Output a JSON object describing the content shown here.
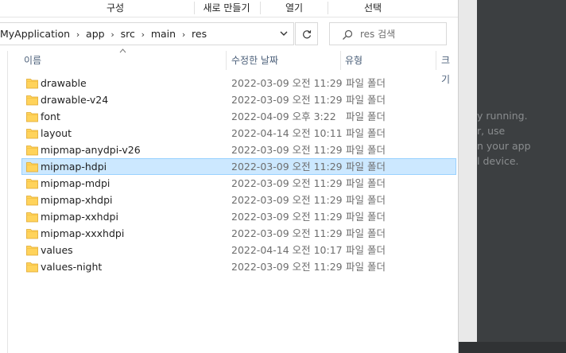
{
  "ribbon": {
    "tabs": [
      {
        "label": "구성"
      },
      {
        "label": "새로 만들기"
      },
      {
        "label": "열기"
      },
      {
        "label": "선택"
      }
    ]
  },
  "address": {
    "crumbs": [
      "MyApplication",
      "app",
      "src",
      "main",
      "res"
    ]
  },
  "search": {
    "placeholder": "res 검색"
  },
  "columns": {
    "name": "이름",
    "date": "수정한 날짜",
    "type": "유형",
    "size": "크기"
  },
  "files": [
    {
      "name": "drawable",
      "date": "2022-03-09 오전 11:29",
      "type": "파일 폴더"
    },
    {
      "name": "drawable-v24",
      "date": "2022-03-09 오전 11:29",
      "type": "파일 폴더"
    },
    {
      "name": "font",
      "date": "2022-04-09 오후 3:22",
      "type": "파일 폴더"
    },
    {
      "name": "layout",
      "date": "2022-04-14 오전 10:11",
      "type": "파일 폴더"
    },
    {
      "name": "mipmap-anydpi-v26",
      "date": "2022-03-09 오전 11:29",
      "type": "파일 폴더"
    },
    {
      "name": "mipmap-hdpi",
      "date": "2022-03-09 오전 11:29",
      "type": "파일 폴더",
      "selected": true
    },
    {
      "name": "mipmap-mdpi",
      "date": "2022-03-09 오전 11:29",
      "type": "파일 폴더"
    },
    {
      "name": "mipmap-xhdpi",
      "date": "2022-03-09 오전 11:29",
      "type": "파일 폴더"
    },
    {
      "name": "mipmap-xxhdpi",
      "date": "2022-03-09 오전 11:29",
      "type": "파일 폴더"
    },
    {
      "name": "mipmap-xxxhdpi",
      "date": "2022-03-09 오전 11:29",
      "type": "파일 폴더"
    },
    {
      "name": "values",
      "date": "2022-04-14 오전 10:17",
      "type": "파일 폴더"
    },
    {
      "name": "values-night",
      "date": "2022-03-09 오전 11:29",
      "type": "파일 폴더"
    }
  ],
  "background_panel": {
    "lines": [
      "y running.",
      "r, use",
      "n your app",
      "l device."
    ]
  },
  "colors": {
    "selection_bg": "#cce8ff",
    "selection_border": "#99d1ff",
    "folder": "#ffd35b",
    "ide_background": "#3c3f41"
  }
}
